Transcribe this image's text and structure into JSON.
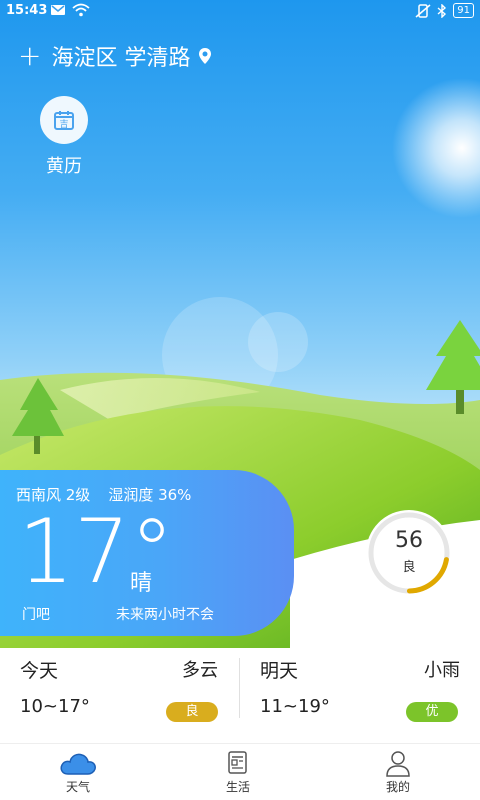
{
  "status_bar": {
    "time": "15:43",
    "battery": "91",
    "icons": [
      "mail-icon",
      "wifi-icon",
      "no-vibrate-icon",
      "bluetooth-icon",
      "battery-icon"
    ]
  },
  "header": {
    "add_icon": "plus-icon",
    "location": "海淀区 学清路",
    "location_icon": "map-pin-icon"
  },
  "shortcut": {
    "label": "黄历",
    "icon": "calendar-icon"
  },
  "current": {
    "wind": "西南风 2级",
    "humidity": "湿润度 36%",
    "temperature": "17°",
    "condition": "晴",
    "ticker_left": "门吧",
    "ticker_right": "未来两小时不会"
  },
  "aqi": {
    "value": "56",
    "level": "良",
    "fraction": 0.22,
    "color": "#e0a800"
  },
  "forecast": [
    {
      "day": "今天",
      "condition": "多云",
      "range": "10~17°",
      "aqi": "良",
      "aqi_color": "#d9ad1e"
    },
    {
      "day": "明天",
      "condition": "小雨",
      "range": "11~19°",
      "aqi": "优",
      "aqi_color": "#7cc42a"
    }
  ],
  "tabs": [
    {
      "label": "天气",
      "icon": "cloud-icon",
      "active": true
    },
    {
      "label": "生活",
      "icon": "newspaper-icon",
      "active": false
    },
    {
      "label": "我的",
      "icon": "person-icon",
      "active": false
    }
  ],
  "colors": {
    "sky_top": "#1e97ee",
    "card": "#4aa6f8",
    "hill": "#8fce2a"
  }
}
